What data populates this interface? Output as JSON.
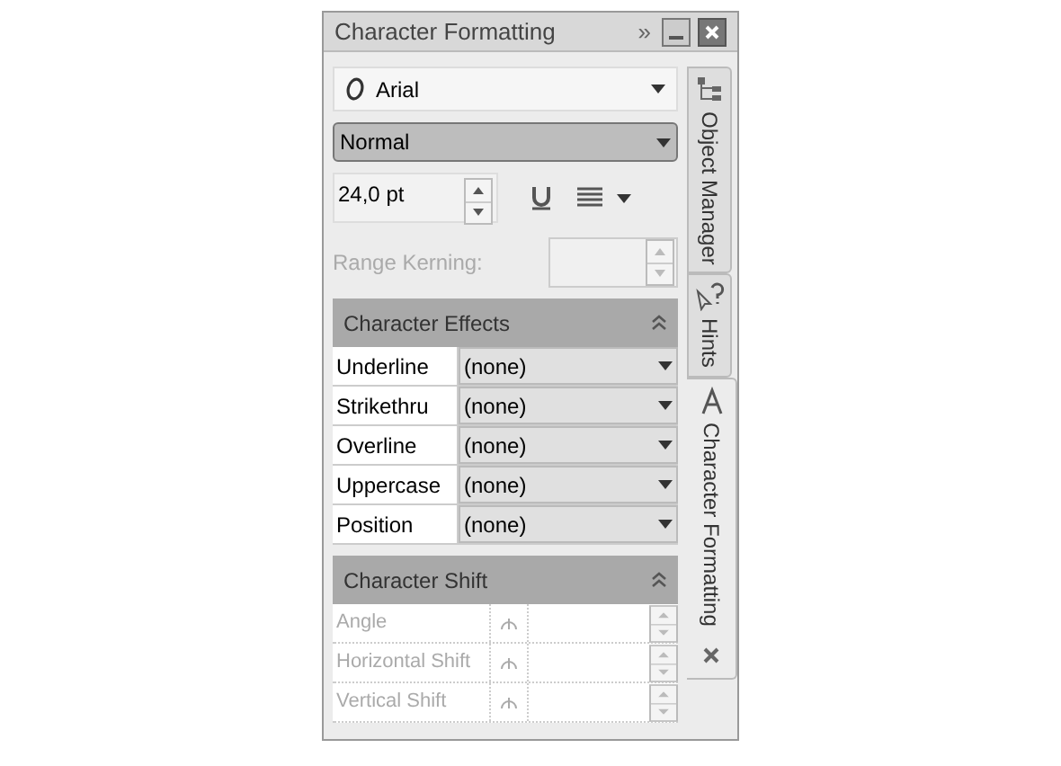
{
  "window": {
    "title": "Character Formatting",
    "overflow_glyph": "»"
  },
  "font": {
    "value": "Arial"
  },
  "style": {
    "value": "Normal"
  },
  "size": {
    "value": "24,0 pt"
  },
  "range_kerning": {
    "label": "Range Kerning:",
    "disabled": true
  },
  "sections": [
    {
      "title": "Character Effects",
      "expanded": true,
      "kind": "dropdowns",
      "rows": [
        {
          "label": "Underline",
          "value": "(none)"
        },
        {
          "label": "Strikethru",
          "value": "(none)"
        },
        {
          "label": "Overline",
          "value": "(none)"
        },
        {
          "label": "Uppercase",
          "value": "(none)"
        },
        {
          "label": "Position",
          "value": "(none)"
        }
      ]
    },
    {
      "title": "Character Shift",
      "expanded": true,
      "kind": "spinners",
      "rows": [
        {
          "label": "Angle",
          "disabled": true
        },
        {
          "label": "Horizontal Shift",
          "disabled": true
        },
        {
          "label": "Vertical Shift",
          "disabled": true
        }
      ]
    }
  ],
  "tabs": [
    {
      "label": "Object Manager",
      "selected": false
    },
    {
      "label": "Hints",
      "selected": false
    },
    {
      "label": "Character Formatting",
      "selected": true
    }
  ]
}
